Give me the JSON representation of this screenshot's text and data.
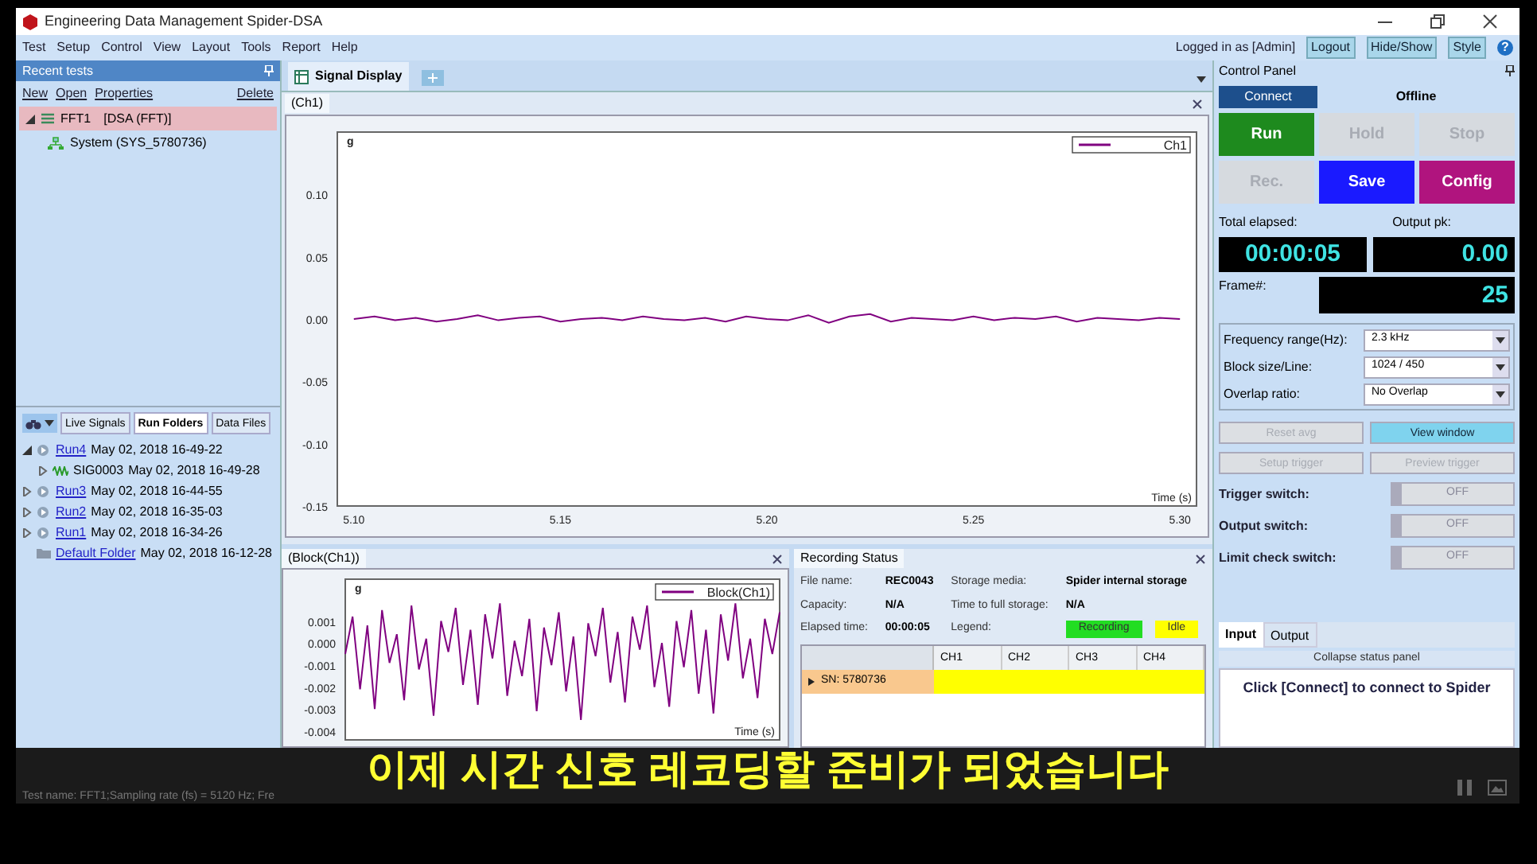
{
  "window": {
    "title": "Engineering Data Management Spider-DSA"
  },
  "menu": [
    "Test",
    "Setup",
    "Control",
    "View",
    "Layout",
    "Tools",
    "Report",
    "Help"
  ],
  "account": {
    "login_text": "Logged in as [Admin]",
    "buttons": [
      "Logout",
      "Hide/Show",
      "Style"
    ],
    "help": "?"
  },
  "recent_tests": {
    "title": "Recent tests",
    "actions": [
      "New",
      "Open",
      "Properties"
    ],
    "delete": "Delete",
    "tree": [
      {
        "label": "FFT1",
        "tag": "[DSA (FFT)]",
        "selected": true,
        "expanded": true,
        "children": [
          {
            "label": "System (SYS_5780736)",
            "selected": false
          }
        ]
      }
    ]
  },
  "browser": {
    "tabs": [
      {
        "label": "Live Signals",
        "selected": false
      },
      {
        "label": "Run Folders",
        "selected": true
      },
      {
        "label": "Data Files",
        "selected": false
      }
    ],
    "tree": [
      {
        "name": "Run4",
        "date": "May 02, 2018 16-49-22",
        "kind": "run",
        "expanded": true,
        "children": [
          {
            "name": "SIG0003",
            "date": "May 02, 2018 16-49-28",
            "kind": "signal",
            "expanded": false
          }
        ]
      },
      {
        "name": "Run3",
        "date": "May 02, 2018 16-44-55",
        "kind": "run",
        "expanded": false
      },
      {
        "name": "Run2",
        "date": "May 02, 2018 16-35-03",
        "kind": "run",
        "expanded": false
      },
      {
        "name": "Run1",
        "date": "May 02, 2018 16-34-26",
        "kind": "run",
        "expanded": false
      },
      {
        "name": "Default Folder",
        "date": "May 02, 2018 16-12-28",
        "kind": "folder"
      }
    ]
  },
  "signal_display": {
    "tab": "Signal Display",
    "plot_tab": "(Ch1)",
    "chart_data": {
      "type": "line",
      "ylabel": "g",
      "xlabel": "Time (s)",
      "xlim": [
        5.096,
        5.304
      ],
      "ylim": [
        -0.15,
        0.15
      ],
      "xticks": [
        {
          "value": 5.1,
          "label": "5.10"
        },
        {
          "value": 5.15,
          "label": "5.15"
        },
        {
          "value": 5.2,
          "label": "5.20"
        },
        {
          "value": 5.25,
          "label": "5.25"
        },
        {
          "value": 5.3,
          "label": "5.30"
        }
      ],
      "yticks": [
        {
          "value": 0.1,
          "label": "0.10"
        },
        {
          "value": 0.05,
          "label": "0.05"
        },
        {
          "value": 0,
          "label": "0.00"
        },
        {
          "value": -0.05,
          "label": "-0.05"
        },
        {
          "value": -0.1,
          "label": "-0.10"
        },
        {
          "value": -0.15,
          "label": "-0.15"
        }
      ],
      "x": [
        5.1,
        5.105,
        5.11,
        5.115,
        5.12,
        5.125,
        5.13,
        5.135,
        5.14,
        5.145,
        5.15,
        5.155,
        5.16,
        5.165,
        5.17,
        5.175,
        5.18,
        5.185,
        5.19,
        5.195,
        5.2,
        5.205,
        5.21,
        5.215,
        5.22,
        5.225,
        5.23,
        5.235,
        5.24,
        5.245,
        5.25,
        5.255,
        5.26,
        5.265,
        5.27,
        5.275,
        5.28,
        5.285,
        5.29,
        5.295,
        5.3
      ],
      "series": [
        {
          "name": "Ch1",
          "color": "#800080",
          "values": [
            0.0,
            0.002,
            -0.001,
            0.001,
            -0.002,
            0.0,
            0.003,
            -0.001,
            0.001,
            0.002,
            -0.002,
            0.0,
            0.001,
            -0.001,
            0.002,
            0.0,
            -0.001,
            0.001,
            -0.002,
            0.002,
            0.0,
            -0.001,
            0.003,
            -0.003,
            0.002,
            0.004,
            -0.002,
            0.001,
            0.0,
            -0.001,
            0.002,
            -0.001,
            0.001,
            0.0,
            0.002,
            -0.002,
            0.001,
            0.0,
            -0.001,
            0.001,
            0.0
          ]
        }
      ]
    }
  },
  "block_panel": {
    "tab": "(Block(Ch1))",
    "chart_data": {
      "type": "line",
      "ylabel": "g",
      "xlabel": "Time (s)",
      "ylim": [
        -0.0044,
        0.0029
      ],
      "yticks": [
        {
          "value": 0.001,
          "label": "0.001"
        },
        {
          "value": 0,
          "label": "0.000"
        },
        {
          "value": -0.001,
          "label": "-0.001"
        },
        {
          "value": -0.002,
          "label": "-0.002"
        },
        {
          "value": -0.003,
          "label": "-0.003"
        },
        {
          "value": -0.004,
          "label": "-0.004"
        }
      ],
      "series": [
        {
          "name": "Block(Ch1)",
          "color": "#800080",
          "values": [
            -0.0005,
            0.0012,
            -0.0021,
            0.0008,
            -0.003,
            0.0015,
            -0.0009,
            0.0004,
            -0.0026,
            0.0017,
            -0.0012,
            0.0002,
            -0.0033,
            0.001,
            -0.0004,
            0.0016,
            -0.0019,
            0.0006,
            -0.0028,
            0.0013,
            -0.0007,
            0.0018,
            -0.0024,
            0.0001,
            -0.0015,
            0.0011,
            -0.0031,
            0.0007,
            -0.001,
            0.0014,
            -0.0022,
            0.0003,
            -0.0035,
            0.0009,
            -0.0006,
            0.0016,
            -0.0018,
            0.0005,
            -0.0027,
            0.0012,
            -0.0003,
            0.0017,
            -0.002,
            0.0,
            -0.0029,
            0.001,
            -0.0011,
            0.0015,
            -0.0023,
            0.0006,
            -0.0032,
            0.0013,
            -0.0008,
            0.0018,
            -0.0016,
            0.0002,
            -0.0025,
            0.0011,
            -0.0005,
            0.0014
          ]
        }
      ]
    }
  },
  "recording_status": {
    "tab": "Recording Status",
    "fields": [
      {
        "label": "File name:",
        "value": "REC0043"
      },
      {
        "label": "Storage media:",
        "value": "Spider internal storage"
      },
      {
        "label": "Capacity:",
        "value": "N/A"
      },
      {
        "label": "Time to full storage:",
        "value": "N/A"
      },
      {
        "label": "Elapsed time:",
        "value": "00:00:05"
      }
    ],
    "legend_label": "Legend:",
    "legend": [
      {
        "label": "Recording",
        "color": "#22dd22"
      },
      {
        "label": "Idle",
        "color": "#ffff00"
      }
    ],
    "columns": [
      "CH1",
      "CH2",
      "CH3",
      "CH4"
    ],
    "rows": [
      {
        "label": "SN: 5780736",
        "color": "#ffff00"
      }
    ]
  },
  "control_panel": {
    "title": "Control Panel",
    "connect": "Connect",
    "status": "Offline",
    "buttons": [
      {
        "label": "Run",
        "kind": "run",
        "disabled": false
      },
      {
        "label": "Hold",
        "kind": "plain",
        "disabled": true
      },
      {
        "label": "Stop",
        "kind": "plain",
        "disabled": true
      },
      {
        "label": "Rec.",
        "kind": "plain",
        "disabled": true
      },
      {
        "label": "Save",
        "kind": "save",
        "disabled": false
      },
      {
        "label": "Config",
        "kind": "config",
        "disabled": false
      }
    ],
    "total_elapsed_label": "Total elapsed:",
    "total_elapsed": "00:00:05",
    "output_pk_label": "Output pk:",
    "output_pk": "0.00",
    "frame_label": "Frame#:",
    "frame": "25",
    "settings": [
      {
        "label": "Frequency range(Hz):",
        "value": "2.3 kHz"
      },
      {
        "label": "Block size/Line:",
        "value": "1024 / 450"
      },
      {
        "label": "Overlap ratio:",
        "value": "No Overlap"
      }
    ],
    "actions": [
      {
        "label": "Reset avg",
        "disabled": true
      },
      {
        "label": "View window",
        "disabled": false
      },
      {
        "label": "Setup trigger",
        "disabled": true
      },
      {
        "label": "Preview trigger",
        "disabled": true
      }
    ],
    "switches": [
      {
        "label": "Trigger switch:",
        "state": "OFF",
        "on": false
      },
      {
        "label": "Output switch:",
        "state": "OFF",
        "on": false
      },
      {
        "label": "Limit check switch:",
        "state": "OFF",
        "on": false
      }
    ],
    "tabs": [
      {
        "label": "Input",
        "selected": true
      },
      {
        "label": "Output",
        "selected": false
      }
    ],
    "collapse": "Collapse status panel",
    "message": "Click [Connect] to connect to Spider"
  },
  "status_bar": "Test name: FFT1;Sampling rate (fs) = 5120 Hz; Fre",
  "subtitle": "이제 시간 신호 레코딩할 준비가 되었습니다"
}
